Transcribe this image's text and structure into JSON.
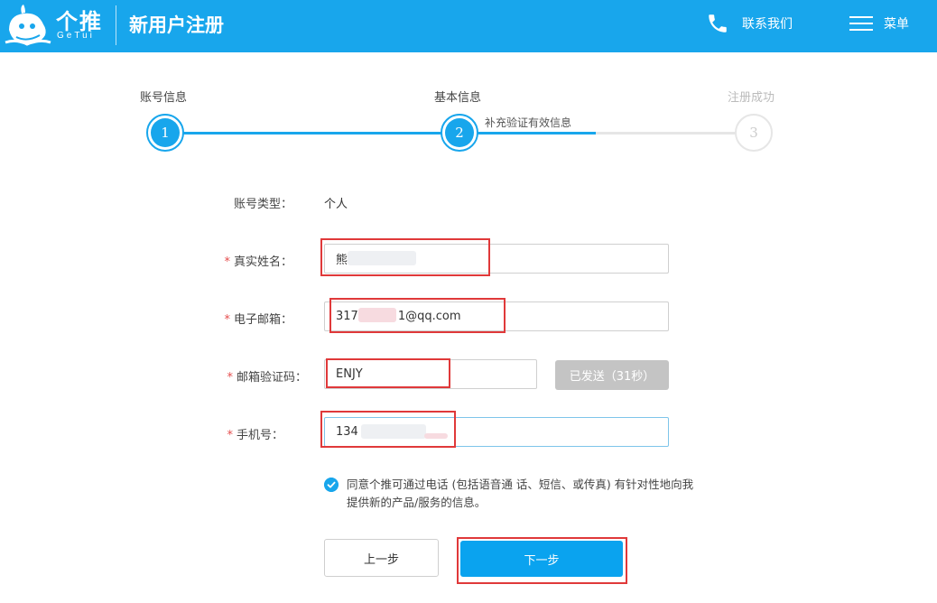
{
  "header": {
    "logo_text": "个推",
    "logo_sub": "GeTui",
    "page_title": "新用户注册",
    "contact_label": "联系我们",
    "menu_label": "菜单",
    "colors": {
      "brand": "#18a6ec"
    }
  },
  "steps": [
    {
      "label": "账号信息",
      "number": "1",
      "state": "done"
    },
    {
      "label": "基本信息",
      "number": "2",
      "state": "current",
      "sub": "补充验证有效信息"
    },
    {
      "label": "注册成功",
      "number": "3",
      "state": "pending"
    }
  ],
  "form": {
    "account_type_label": "账号类型：",
    "account_type_value": "个人",
    "real_name_label": "真实姓名：",
    "real_name_value": "熊",
    "email_label": "电子邮箱：",
    "email_value_prefix": "317",
    "email_value_suffix": "1@qq.com",
    "code_label": "邮箱验证码：",
    "code_value": "ENJY",
    "send_button": "已发送（31秒）",
    "phone_label": "手机号：",
    "phone_value": "134",
    "required_mark": "*"
  },
  "agreement": {
    "text": "同意个推可通过电话 (包括语音通 话、短信、或传真) 有针对性地向我提供新的产品/服务的信息。",
    "checked": true
  },
  "buttons": {
    "prev": "上一步",
    "next": "下一步"
  }
}
